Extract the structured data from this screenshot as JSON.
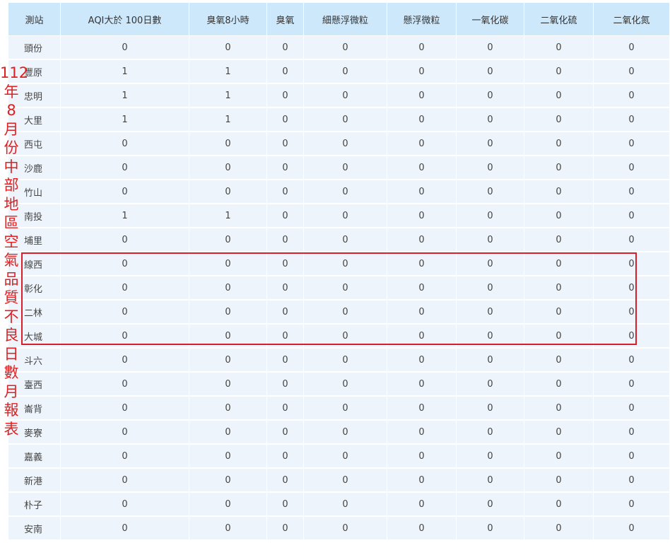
{
  "table": {
    "headers": [
      "測站",
      "AQI大於 100日數",
      "臭氧8小時",
      "臭氧",
      "細懸浮微粒",
      "懸浮微粒",
      "一氧化碳",
      "二氧化硫",
      "二氧化氮"
    ],
    "rows": [
      [
        "頭份",
        "0",
        "0",
        "0",
        "0",
        "0",
        "0",
        "0",
        "0"
      ],
      [
        "豐原",
        "1",
        "1",
        "0",
        "0",
        "0",
        "0",
        "0",
        "0"
      ],
      [
        "忠明",
        "1",
        "1",
        "0",
        "0",
        "0",
        "0",
        "0",
        "0"
      ],
      [
        "大里",
        "1",
        "1",
        "0",
        "0",
        "0",
        "0",
        "0",
        "0"
      ],
      [
        "西屯",
        "0",
        "0",
        "0",
        "0",
        "0",
        "0",
        "0",
        "0"
      ],
      [
        "沙鹿",
        "0",
        "0",
        "0",
        "0",
        "0",
        "0",
        "0",
        "0"
      ],
      [
        "竹山",
        "0",
        "0",
        "0",
        "0",
        "0",
        "0",
        "0",
        "0"
      ],
      [
        "南投",
        "1",
        "1",
        "0",
        "0",
        "0",
        "0",
        "0",
        "0"
      ],
      [
        "埔里",
        "0",
        "0",
        "0",
        "0",
        "0",
        "0",
        "0",
        "0"
      ],
      [
        "線西",
        "0",
        "0",
        "0",
        "0",
        "0",
        "0",
        "0",
        "0"
      ],
      [
        "彰化",
        "0",
        "0",
        "0",
        "0",
        "0",
        "0",
        "0",
        "0"
      ],
      [
        "二林",
        "0",
        "0",
        "0",
        "0",
        "0",
        "0",
        "0",
        "0"
      ],
      [
        "大城",
        "0",
        "0",
        "0",
        "0",
        "0",
        "0",
        "0",
        "0"
      ],
      [
        "斗六",
        "0",
        "0",
        "0",
        "0",
        "0",
        "0",
        "0",
        "0"
      ],
      [
        "臺西",
        "0",
        "0",
        "0",
        "0",
        "0",
        "0",
        "0",
        "0"
      ],
      [
        "崙背",
        "0",
        "0",
        "0",
        "0",
        "0",
        "0",
        "0",
        "0"
      ],
      [
        "麥寮",
        "0",
        "0",
        "0",
        "0",
        "0",
        "0",
        "0",
        "0"
      ],
      [
        "嘉義",
        "0",
        "0",
        "0",
        "0",
        "0",
        "0",
        "0",
        "0"
      ],
      [
        "新港",
        "0",
        "0",
        "0",
        "0",
        "0",
        "0",
        "0",
        "0"
      ],
      [
        "朴子",
        "0",
        "0",
        "0",
        "0",
        "0",
        "0",
        "0",
        "0"
      ],
      [
        "安南",
        "0",
        "0",
        "0",
        "0",
        "0",
        "0",
        "0",
        "0"
      ]
    ]
  },
  "annotation": {
    "title_chars": [
      "112",
      "年",
      "8",
      "月",
      "份",
      "中",
      "部",
      "地",
      "區",
      "空",
      "氣",
      "品",
      "質",
      "不",
      "良",
      "日",
      "數",
      "月",
      "報",
      "表"
    ],
    "title_color": "#e02020",
    "highlight_color": "#d81e28",
    "highlighted_stations": [
      "線西",
      "彰化",
      "二林",
      "大城"
    ]
  },
  "colors": {
    "header_bg": "#cde8fb",
    "row_bg": "#eef4fb"
  }
}
